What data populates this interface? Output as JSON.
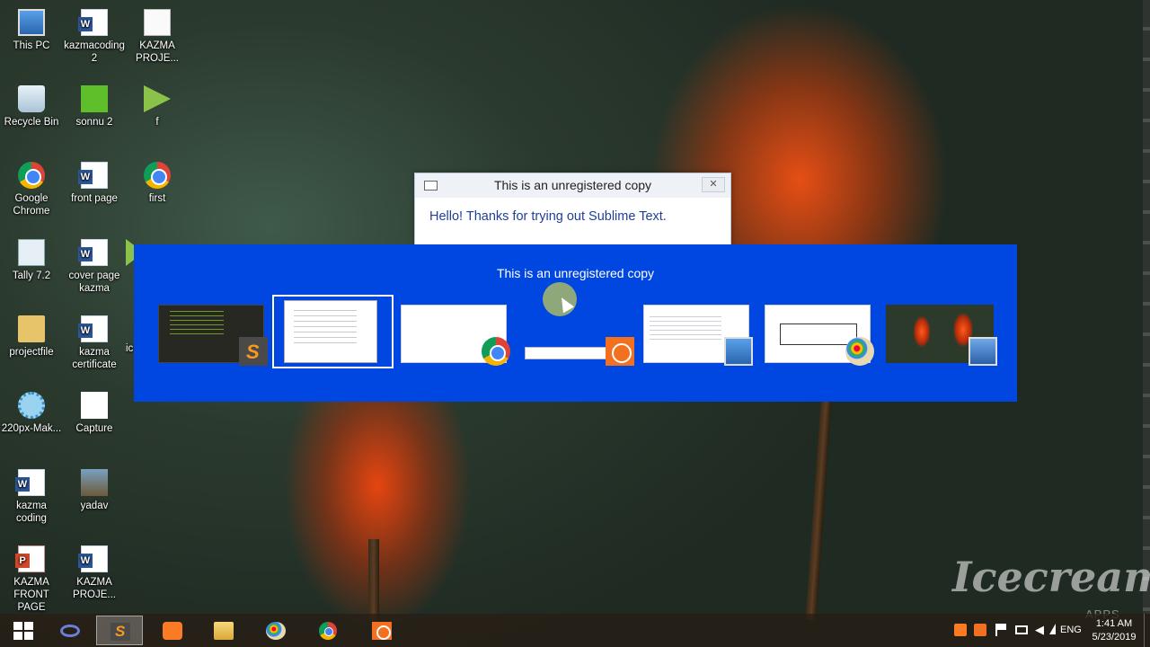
{
  "desktop": {
    "icons": [
      {
        "label": "This PC",
        "icon": "computer-icon"
      },
      {
        "label": "kazmacoding 2",
        "icon": "word-doc-icon"
      },
      {
        "label": "KAZMA PROJE...",
        "icon": "document-icon"
      },
      {
        "label": "Recycle Bin",
        "icon": "recycle-bin-icon"
      },
      {
        "label": "sonnu 2",
        "icon": "green-file-icon"
      },
      {
        "label": "f",
        "icon": "vlc-media-icon"
      },
      {
        "label": "Google Chrome",
        "icon": "chrome-icon"
      },
      {
        "label": "front page",
        "icon": "word-doc-icon"
      },
      {
        "label": "first",
        "icon": "chrome-icon"
      },
      {
        "label": "Tally 7.2",
        "icon": "tally-icon"
      },
      {
        "label": "cover page kazma",
        "icon": "word-doc-icon"
      },
      {
        "label": "projectfile",
        "icon": "folder-icon"
      },
      {
        "label": "kazma certificate",
        "icon": "word-doc-icon"
      },
      {
        "label": "220px-Mak...",
        "icon": "image-icon"
      },
      {
        "label": "Capture",
        "icon": "capture-image-icon"
      },
      {
        "label": "kazma coding",
        "icon": "word-doc-icon"
      },
      {
        "label": "yadav",
        "icon": "photo-icon"
      },
      {
        "label": "KAZMA FRONT PAGE",
        "icon": "powerpoint-icon"
      },
      {
        "label": "KAZMA PROJE...",
        "icon": "word-doc-icon"
      }
    ],
    "partial_label": "ic"
  },
  "dialog": {
    "title": "This is an unregistered copy",
    "close_label": "✕",
    "message": "Hello! Thanks for trying out Sublime Text."
  },
  "switcher": {
    "title": "This is an unregistered copy",
    "selected_index": 1,
    "windows": [
      {
        "app": "Sublime Text",
        "badge": "sublime-icon"
      },
      {
        "app": "Sublime Text dialog",
        "badge": "none"
      },
      {
        "app": "Google Chrome",
        "badge": "chrome-icon"
      },
      {
        "app": "Icecream Screen Recorder",
        "badge": "recorder-icon"
      },
      {
        "app": "File Explorer",
        "badge": "computer-icon"
      },
      {
        "app": "Paint",
        "badge": "paint-icon"
      },
      {
        "app": "Desktop",
        "badge": "desktop-icon"
      }
    ]
  },
  "watermark": {
    "brand": "Icecream",
    "sub": "APPS"
  },
  "taskbar": {
    "buttons": [
      {
        "name": "start",
        "icon": "windows-logo-icon"
      },
      {
        "name": "infinity-app",
        "icon": "infinity-icon"
      },
      {
        "name": "sublime-text",
        "icon": "sublime-icon",
        "active": true
      },
      {
        "name": "xampp",
        "icon": "xampp-icon"
      },
      {
        "name": "file-explorer",
        "icon": "folder-icon"
      },
      {
        "name": "paint",
        "icon": "paint-icon"
      },
      {
        "name": "chrome",
        "icon": "chrome-icon"
      },
      {
        "name": "screen-recorder",
        "icon": "recorder-icon"
      }
    ],
    "tray": {
      "language": "ENG",
      "time": "1:41 AM",
      "date": "5/23/2019"
    }
  },
  "colors": {
    "switcher_bg": "#0046e0",
    "dialog_text": "#1f3f99"
  }
}
